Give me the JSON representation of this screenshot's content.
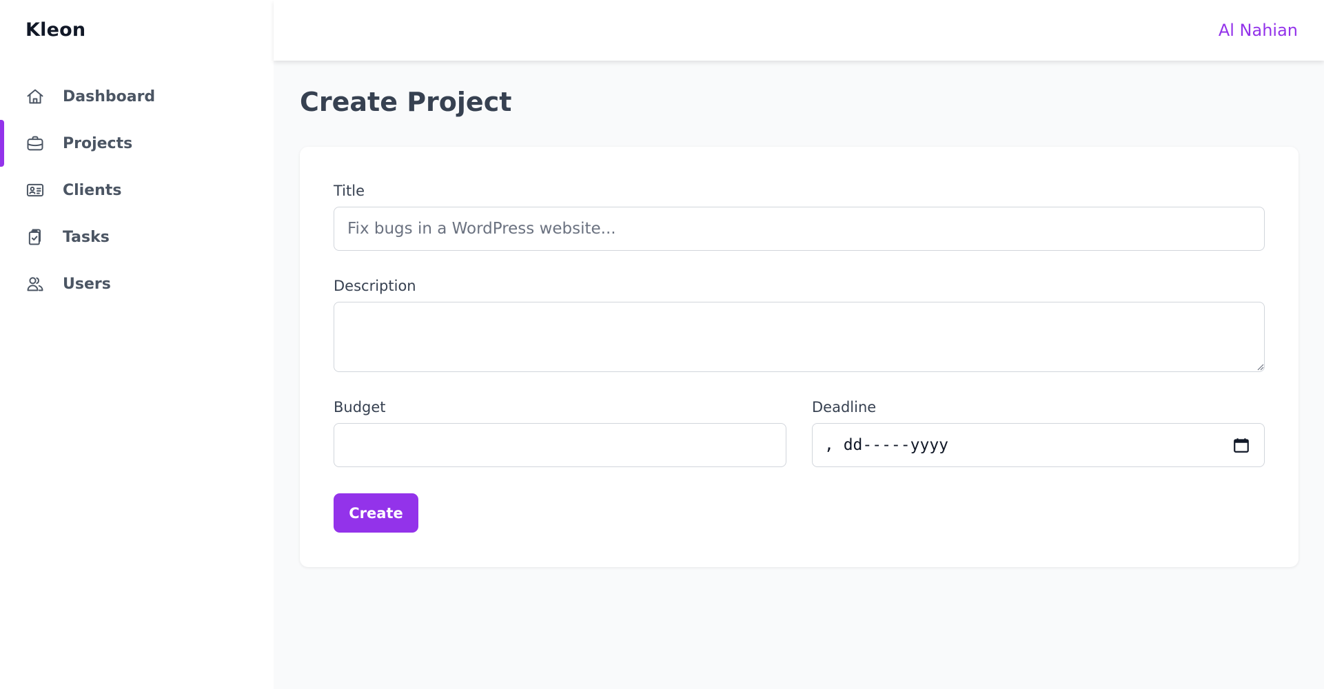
{
  "app": {
    "brand": "Kleon"
  },
  "header": {
    "user_name": "Al Nahian"
  },
  "sidebar": {
    "items": [
      {
        "label": "Dashboard",
        "icon": "home-icon",
        "active": false
      },
      {
        "label": "Projects",
        "icon": "briefcase-icon",
        "active": true
      },
      {
        "label": "Clients",
        "icon": "id-card-icon",
        "active": false
      },
      {
        "label": "Tasks",
        "icon": "clipboard-check-icon",
        "active": false
      },
      {
        "label": "Users",
        "icon": "users-icon",
        "active": false
      }
    ]
  },
  "page": {
    "title": "Create Project"
  },
  "form": {
    "title_label": "Title",
    "title_placeholder": "Fix bugs in a WordPress website...",
    "title_value": "",
    "description_label": "Description",
    "description_value": "",
    "budget_label": "Budget",
    "budget_value": "",
    "deadline_label": "Deadline",
    "deadline_placeholder": ", dd-----yyyy",
    "submit_label": "Create"
  },
  "colors": {
    "accent": "#9333ea",
    "text": "#374151",
    "muted": "#4b5563",
    "background": "#f9fafb"
  }
}
